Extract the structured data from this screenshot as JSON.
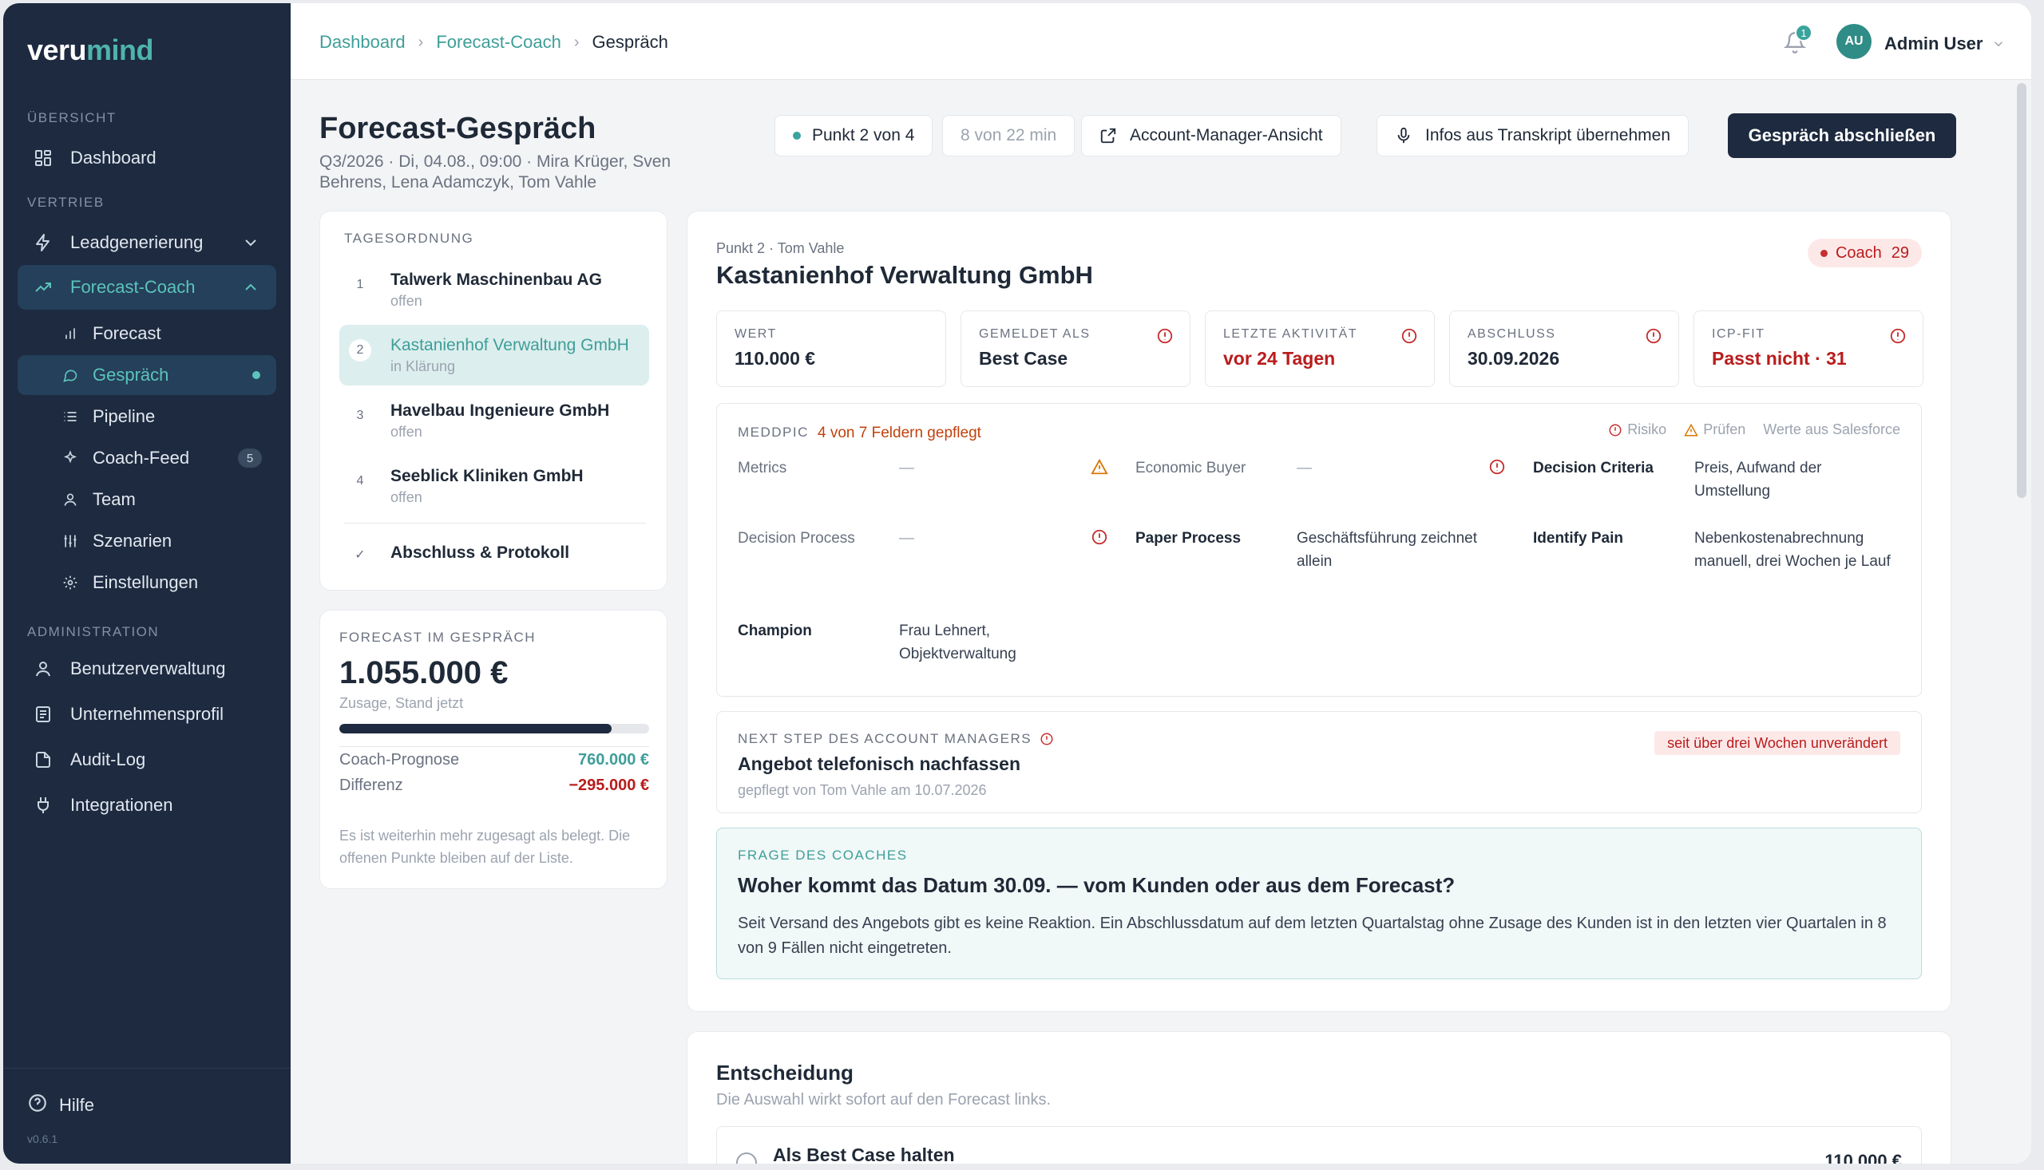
{
  "brand": {
    "logo_a": "veru",
    "logo_b": "mind"
  },
  "sidebar": {
    "sections": {
      "overview": "ÜBERSICHT",
      "sales": "VERTRIEB",
      "admin": "ADMINISTRATION"
    },
    "dashboard": "Dashboard",
    "lead_gen": "Leadgenerierung",
    "forecast_coach": "Forecast-Coach",
    "sub": {
      "forecast": "Forecast",
      "conversation": "Gespräch",
      "pipeline": "Pipeline",
      "coach_feed": "Coach-Feed",
      "coach_feed_count": "5",
      "team": "Team",
      "scenarios": "Szenarien",
      "settings": "Einstellungen"
    },
    "users": "Benutzerverwaltung",
    "company": "Unternehmensprofil",
    "audit": "Audit-Log",
    "integrations": "Integrationen",
    "help": "Hilfe",
    "version": "v0.6.1"
  },
  "header": {
    "breadcrumb": [
      "Dashboard",
      "Forecast-Coach",
      "Gespräch"
    ],
    "notifications": "1",
    "avatar_initials": "AU",
    "user_name": "Admin User"
  },
  "page": {
    "title": "Forecast-Gespräch",
    "subtitle": "Q3/2026 · Di, 04.08., 09:00 · Mira Krüger, Sven Behrens, Lena Adamczyk, Tom Vahle",
    "step": "Punkt 2 von 4",
    "timer": "8 von 22 min",
    "am_view": "Account-Manager-Ansicht",
    "transcript": "Infos aus Transkript übernehmen",
    "finish": "Gespräch abschließen"
  },
  "agenda": {
    "title": "TAGESORDNUNG",
    "items": [
      {
        "num": "1",
        "name": "Talwerk Maschinenbau AG",
        "state": "offen"
      },
      {
        "num": "2",
        "name": "Kastanienhof Verwaltung GmbH",
        "state": "in Klärung"
      },
      {
        "num": "3",
        "name": "Havelbau Ingenieure GmbH",
        "state": "offen"
      },
      {
        "num": "4",
        "name": "Seeblick Kliniken GmbH",
        "state": "offen"
      }
    ],
    "closing": "Abschluss & Protokoll"
  },
  "forecast": {
    "label": "FORECAST IM GESPRÄCH",
    "value": "1.055.000 €",
    "sub": "Zusage, Stand jetzt",
    "progress": 0.88,
    "coach_label": "Coach-Prognose",
    "coach_value": "760.000 €",
    "diff_label": "Differenz",
    "diff_value": "−295.000 €",
    "note": "Es ist weiterhin mehr zugesagt als belegt. Die offenen Punkte bleiben auf der Liste."
  },
  "detail": {
    "kicker": "Punkt 2 · Tom Vahle",
    "title": "Kastanienhof Verwaltung GmbH",
    "coach_label": "Coach",
    "coach_score": "29",
    "metrics": [
      {
        "label": "WERT",
        "value": "110.000 €"
      },
      {
        "label": "GEMELDET ALS",
        "value": "Best Case"
      },
      {
        "label": "LETZTE AKTIVITÄT",
        "value": "vor 24 Tagen"
      },
      {
        "label": "ABSCHLUSS",
        "value": "30.09.2026"
      },
      {
        "label": "ICP-FIT",
        "value": "Passt nicht · 31"
      }
    ],
    "meddpic": {
      "label": "MEDDPIC",
      "count": "4 von 7 Feldern gepflegt",
      "legend_risk": "Risiko",
      "legend_check": "Prüfen",
      "legend_sf": "Werte aus Salesforce",
      "metrics_l": "Metrics",
      "metrics_v": "—",
      "eb_l": "Economic Buyer",
      "eb_v": "—",
      "dc_l": "Decision Criteria",
      "dc_v": "Preis, Aufwand der Umstellung",
      "dp_l": "Decision Process",
      "dp_v": "—",
      "pp_l": "Paper Process",
      "pp_v": "Geschäftsführung zeichnet allein",
      "ip_l": "Identify Pain",
      "ip_v": "Nebenkostenabrechnung manuell, drei Wochen je Lauf",
      "ch_l": "Champion",
      "ch_v": "Frau Lehnert, Objektverwaltung"
    },
    "next_step": {
      "label": "NEXT STEP DES ACCOUNT MANAGERS",
      "title": "Angebot telefonisch nachfassen",
      "meta": "gepflegt von Tom Vahle am 10.07.2026",
      "badge": "seit über drei Wochen unverändert"
    },
    "coach_question": {
      "label": "FRAGE DES COACHES",
      "title": "Woher kommt das Datum 30.09. — vom Kunden oder aus dem Forecast?",
      "text": "Seit Versand des Angebots gibt es keine Reaktion. Ein Abschlussdatum auf dem letzten Quartalstag ohne Zusage des Kunden ist in den letzten vier Quartalen in 8 von 9 Fällen nicht eingetreten."
    }
  },
  "decision": {
    "title": "Entscheidung",
    "sub": "Die Auswahl wirkt sofort auf den Forecast links.",
    "option_label": "Als Best Case halten",
    "option_amount": "110.000 €"
  },
  "colors": {
    "sidebar": "#1d2a3f",
    "accent": "#3e9e99",
    "danger": "#b91c1c",
    "warning": "#c2410c"
  }
}
